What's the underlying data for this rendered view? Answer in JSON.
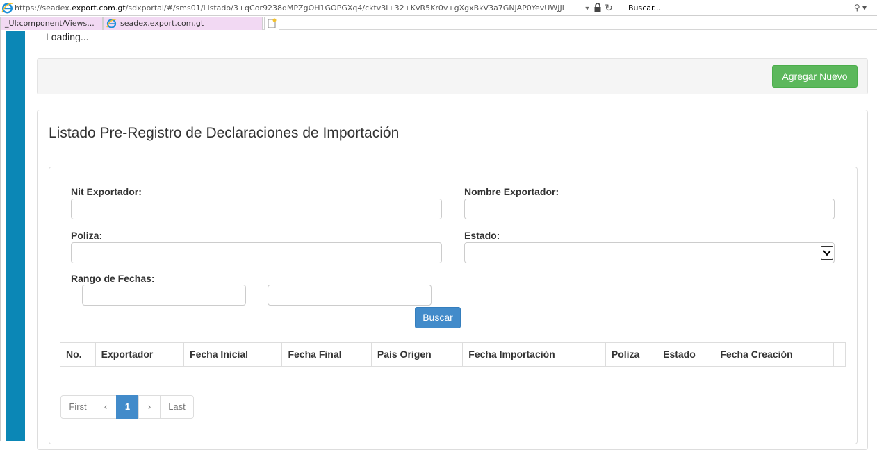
{
  "browser": {
    "url_prefix": "https://seadex.",
    "url_host": "export.com.gt",
    "url_path": "/sdxportal/#/sms01/Listado/3+qCor9238qMPZgOH1GOPGXq4/cktv3i+32+KvR5Kr0v+gXgxBkV3a7GNjAP0YevUWJJl",
    "search_placeholder": "Buscar...",
    "tabs": [
      {
        "label": "_UI;component/Views..."
      },
      {
        "label": "seadex.export.com.gt"
      }
    ],
    "icons": {
      "site": "internet-explorer-icon",
      "lock": "lock-icon",
      "refresh": "refresh-icon",
      "search": "search-icon",
      "new_tab": "new-tab-icon",
      "close": "close-icon"
    }
  },
  "page": {
    "loading_text": "Loading...",
    "add_button_label": "Agregar Nuevo",
    "title": "Listado Pre-Registro de Declaraciones de Importación",
    "filters": {
      "nit_label": "Nit Exportador:",
      "nit_value": "",
      "nombre_label": "Nombre Exportador:",
      "nombre_value": "",
      "poliza_label": "Poliza:",
      "poliza_value": "",
      "estado_label": "Estado:",
      "estado_value": "",
      "rango_label": "Rango de Fechas:",
      "fecha_desde_value": "",
      "fecha_hasta_value": ""
    },
    "search_button_label": "Buscar",
    "table": {
      "columns": [
        "No.",
        "Exportador",
        "Fecha Inicial",
        "Fecha Final",
        "País Origen",
        "Fecha Importación",
        "Poliza",
        "Estado",
        "Fecha Creación"
      ],
      "rows": []
    },
    "pagination": {
      "first": "First",
      "prev": "‹",
      "current": "1",
      "next": "›",
      "last": "Last"
    }
  },
  "colors": {
    "left_strip": "#0b87b6",
    "add_button": "#5cb85c",
    "primary_button": "#428bca",
    "tab_background": "#f2d9f3"
  }
}
